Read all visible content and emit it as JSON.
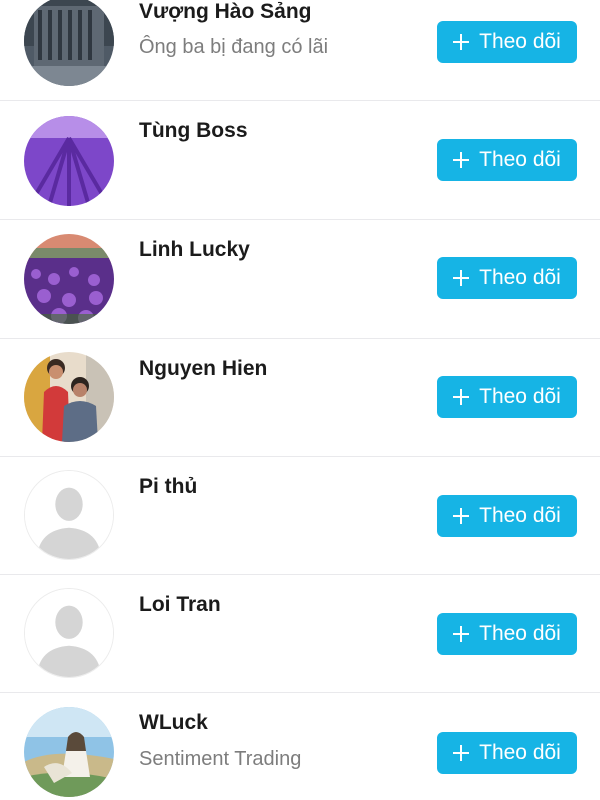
{
  "users": [
    {
      "name": "Vượng Hào Sảng",
      "subtitle": "Ông ba bị đang có lãi",
      "avatar": "building-photo-avatar"
    },
    {
      "name": "Tùng Boss",
      "subtitle": "",
      "avatar": "lavender-field-photo-avatar"
    },
    {
      "name": "Linh Lucky",
      "subtitle": "",
      "avatar": "purple-flower-field-photo-avatar"
    },
    {
      "name": "Nguyen Hien",
      "subtitle": "",
      "avatar": "couple-photo-avatar"
    },
    {
      "name": "Pi thủ",
      "subtitle": "",
      "avatar": "default-person-avatar"
    },
    {
      "name": "Loi Tran",
      "subtitle": "",
      "avatar": "default-person-avatar"
    },
    {
      "name": "WLuck",
      "subtitle": "Sentiment Trading",
      "avatar": "anime-illustration-avatar"
    }
  ],
  "follow_label": "Theo dõi",
  "colors": {
    "follow_button": "#16b4e5",
    "name_text": "#1b1b1b",
    "subtitle_text": "#7d7d7d",
    "divider": "#e9e9ec"
  }
}
